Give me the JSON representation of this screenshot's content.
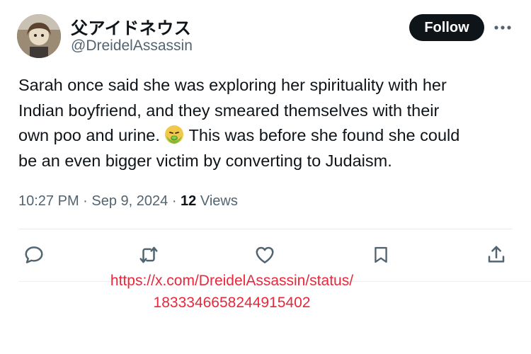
{
  "author": {
    "display_name": "父アイドネウス",
    "handle": "@DreidelAssassin",
    "avatar_alt": "avatar"
  },
  "header": {
    "follow_label": "Follow",
    "more_icon": "more-horizontal-icon"
  },
  "tweet": {
    "lines": [
      "Sarah once said she was exploring her spirituality with her",
      "Indian boyfriend, and they smeared themselves with their",
      "own poo and urine.",
      " This was before she found she could",
      "be an even bigger victim by converting to Judaism."
    ],
    "emoji": "nauseated-face-emoji"
  },
  "meta": {
    "time": "10:27 PM",
    "separator": " · ",
    "date": "Sep 9, 2024",
    "views_count": "12",
    "views_label": " Views"
  },
  "actions": [
    "reply-icon",
    "retweet-icon",
    "like-icon",
    "bookmark-icon",
    "share-icon"
  ],
  "watermark": {
    "url_line1": "https://x.com/DreidelAssassin/status/",
    "url_line2": "1833346658244915402"
  },
  "colors": {
    "text": "#0f1419",
    "secondary": "#536471",
    "follow_bg": "#0f1419",
    "watermark": "#e8283c"
  }
}
